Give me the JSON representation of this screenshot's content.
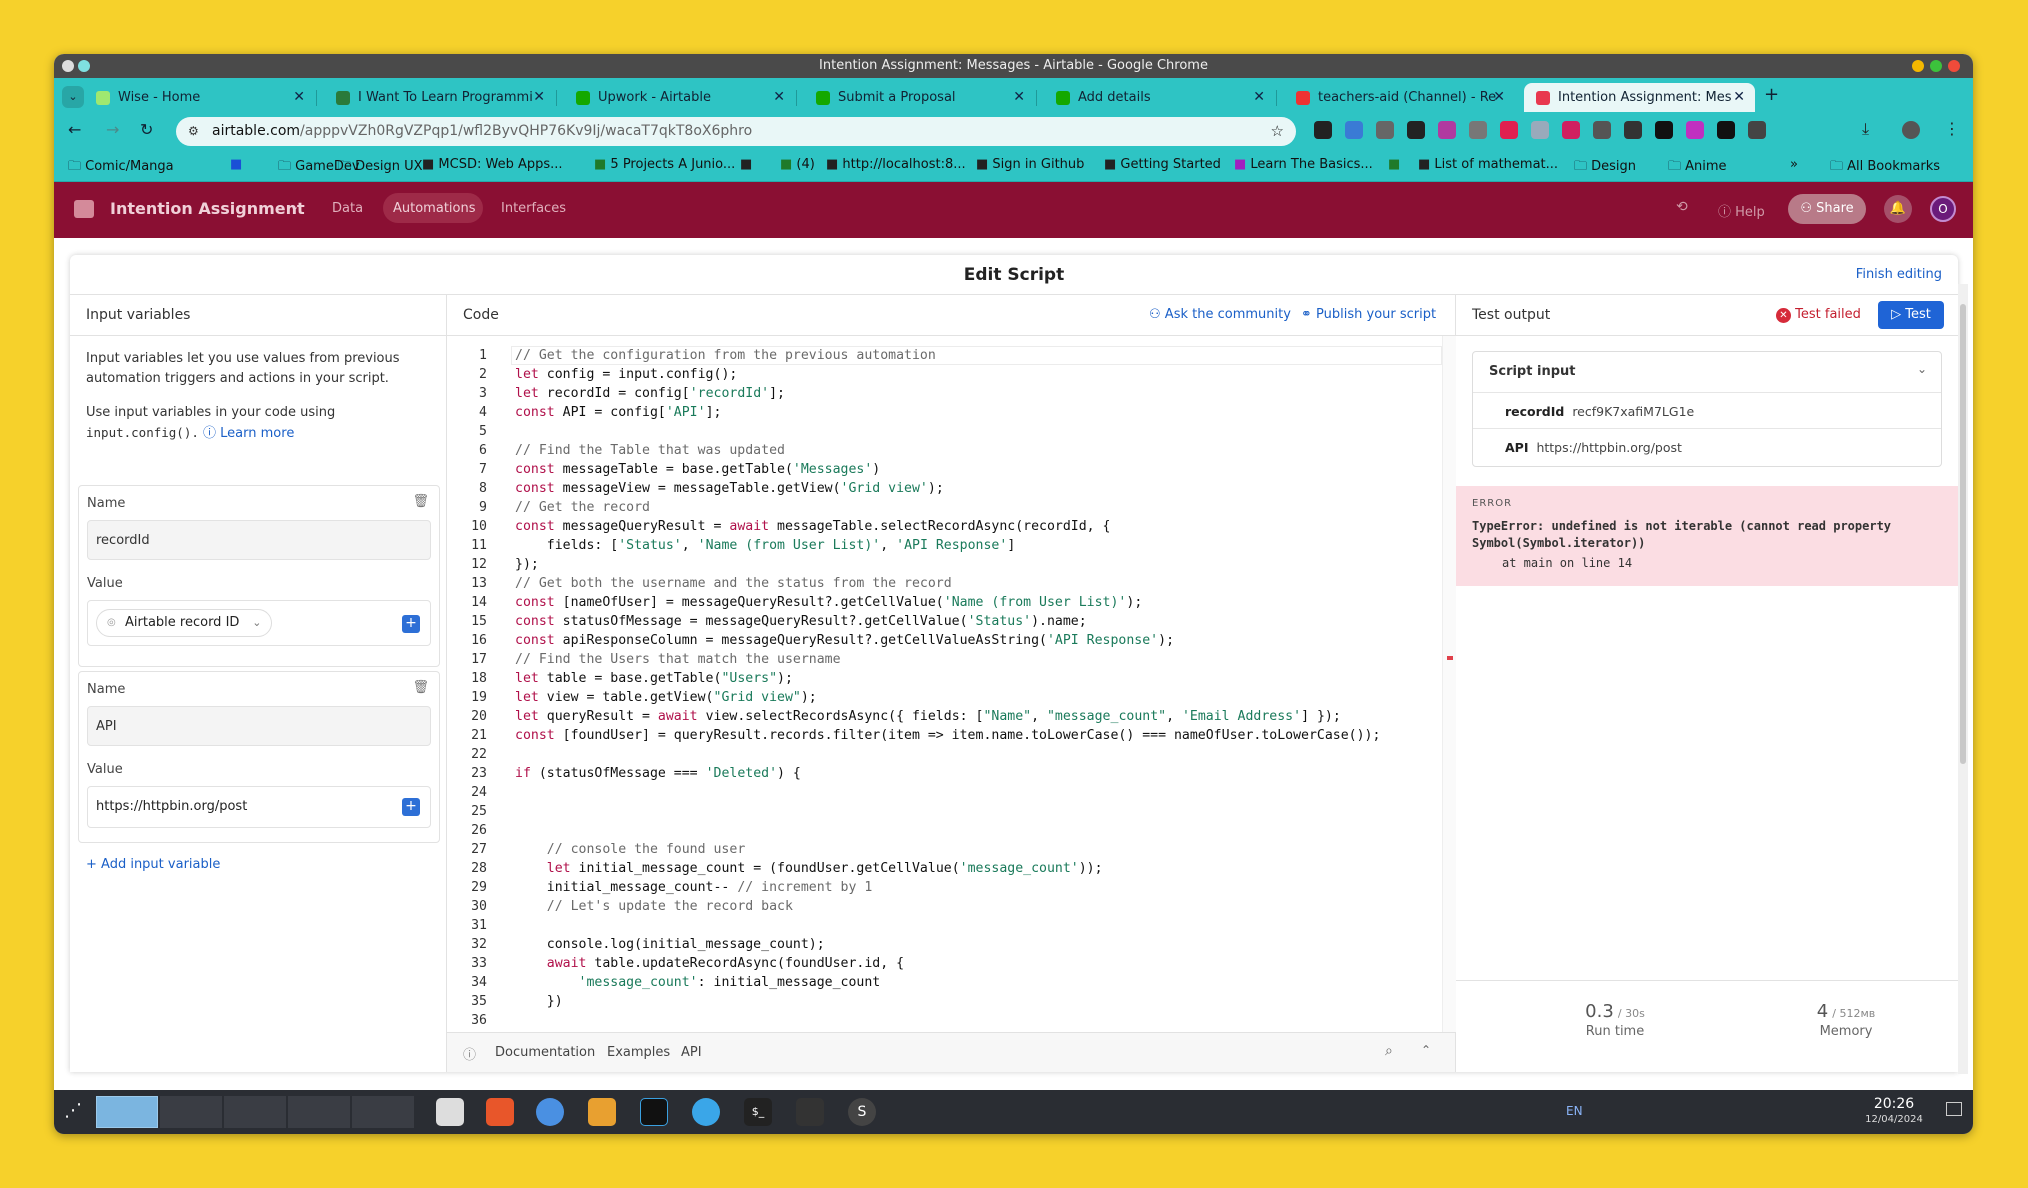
{
  "window": {
    "title": "Intention Assignment: Messages - Airtable - Google Chrome"
  },
  "tabs": [
    {
      "label": "Wise - Home",
      "color": "#9fe870"
    },
    {
      "label": "I Want To Learn Programmi",
      "color": "#2a7a3a"
    },
    {
      "label": "Upwork - Airtable",
      "color": "#14a800"
    },
    {
      "label": "Submit a Proposal",
      "color": "#14a800"
    },
    {
      "label": "Add details",
      "color": "#14a800"
    },
    {
      "label": "teachers-aid (Channel) - Re",
      "color": "#e33"
    },
    {
      "label": "Intention Assignment: Mes",
      "color": "#e8384f"
    }
  ],
  "address": {
    "domain": "airtable.com",
    "path": "/apppvVZh0RgVZPqp1/wfl2ByvQHP76Kv9Ij/wacaT7qkT8oX6phro"
  },
  "bookmarks": [
    "Comic/Manga",
    "",
    "GameDev",
    "Design UX",
    "MCSD: Web Apps...",
    "5 Projects A Junio...",
    "",
    "(4)",
    "http://localhost:8...",
    "Sign in Github",
    "Getting Started",
    "Learn The Basics...",
    "",
    "List of mathemat...",
    "Design",
    "Anime",
    "All Bookmarks"
  ],
  "app": {
    "base_name": "Intention Assignment",
    "nav": [
      "Data",
      "Automations",
      "Interfaces"
    ],
    "help": "Help",
    "share": "Share",
    "avatar": "O"
  },
  "modal": {
    "title": "Edit Script",
    "finish": "Finish editing"
  },
  "inputs": {
    "header": "Input variables",
    "desc1": "Input variables let you use values from previous automation triggers and actions in your script.",
    "desc2a": "Use input variables in your code using",
    "desc2code": "input.config().",
    "learn_more": "Learn more",
    "name_label": "Name",
    "value_label": "Value",
    "var1_name": "recordId",
    "var1_value": "Airtable record ID",
    "var2_name": "API",
    "var2_value": "https://httpbin.org/post",
    "add": "Add input variable"
  },
  "code": {
    "header": "Code",
    "ask": "Ask the community",
    "publish": "Publish your script",
    "footer": [
      "Documentation",
      "Examples",
      "API"
    ],
    "lines": [
      "// Get the configuration from the previous automation",
      "let config = input.config();",
      "let recordId = config['recordId'];",
      "const API = config['API'];",
      "",
      "// Find the Table that was updated",
      "const messageTable = base.getTable('Messages')",
      "const messageView = messageTable.getView('Grid view');",
      "// Get the record",
      "const messageQueryResult = await messageTable.selectRecordAsync(recordId, {",
      "    fields: ['Status', 'Name (from User List)', 'API Response']",
      "});",
      "// Get both the username and the status from the record",
      "const [nameOfUser] = messageQueryResult?.getCellValue('Name (from User List)');",
      "const statusOfMessage = messageQueryResult?.getCellValue('Status').name;",
      "const apiResponseColumn = messageQueryResult?.getCellValueAsString('API Response');",
      "// Find the Users that match the username",
      "let table = base.getTable(\"Users\");",
      "let view = table.getView(\"Grid view\");",
      "let queryResult = await view.selectRecordsAsync({ fields: [\"Name\", \"message_count\", 'Email Address'] });",
      "const [foundUser] = queryResult.records.filter(item => item.name.toLowerCase() === nameOfUser.toLowerCase());",
      "",
      "if (statusOfMessage === 'Deleted') {",
      "",
      "",
      "",
      "    // console the found user",
      "    let initial_message_count = (foundUser.getCellValue('message_count'));",
      "    initial_message_count-- // increment by 1",
      "    // Let's update the record back",
      "",
      "    console.log(initial_message_count);",
      "    await table.updateRecordAsync(foundUser.id, {",
      "        'message_count': initial_message_count",
      "    })",
      ""
    ]
  },
  "output": {
    "header": "Test output",
    "status": "Test failed",
    "test": "Test",
    "script_input": "Script input",
    "rows": [
      {
        "k": "recordId",
        "v": "recf9K7xafiM7LG1e"
      },
      {
        "k": "API",
        "v": "https://httpbin.org/post"
      }
    ],
    "error_label": "ERROR",
    "error_msg": "TypeError: undefined is not iterable (cannot read property Symbol(Symbol.iterator))",
    "error_loc": "at main on line 14",
    "runtime": "0.3",
    "runtime_max": "/ 30s",
    "runtime_label": "Run time",
    "memory": "4",
    "memory_max": "/ 512мв",
    "memory_label": "Memory"
  },
  "taskbar": {
    "lang": "EN",
    "time": "20:26",
    "date": "12/04/2024"
  }
}
